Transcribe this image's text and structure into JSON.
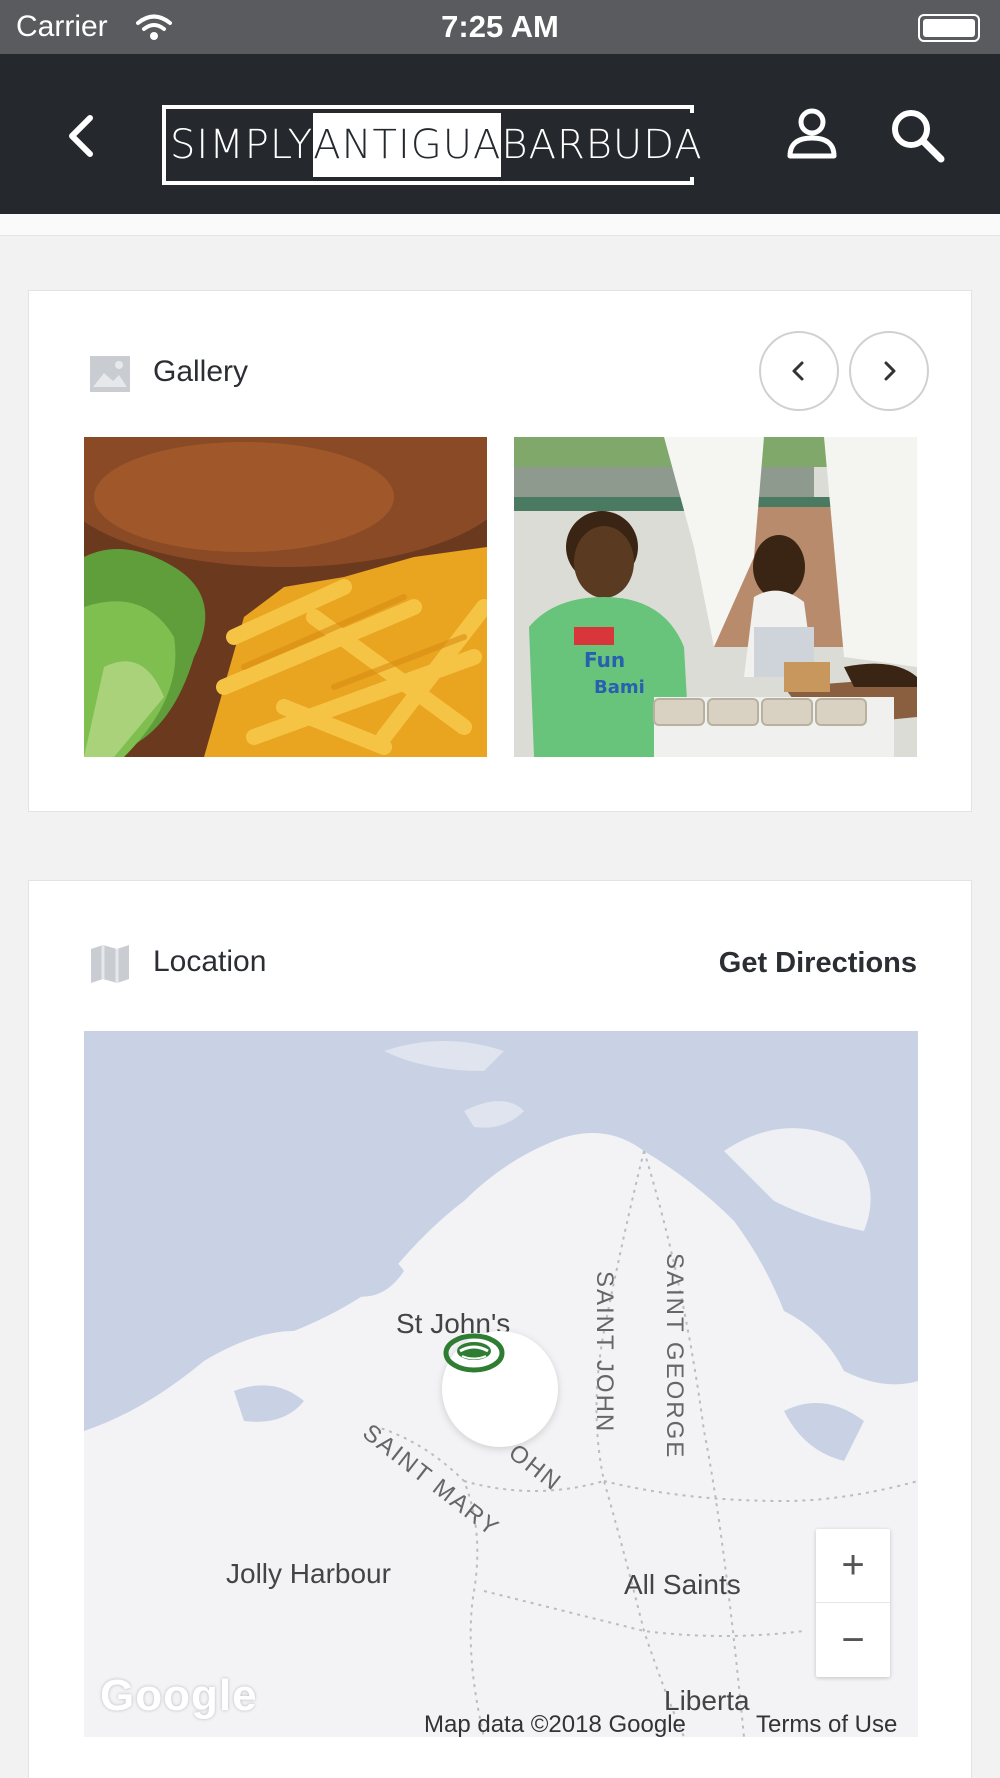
{
  "status_bar": {
    "carrier": "Carrier",
    "time": "7:25 AM"
  },
  "nav": {
    "logo_words": [
      "SIMPLY",
      "ANTIGUA",
      "BARBUDA"
    ],
    "back_icon": "chevron-left-icon",
    "user_icon": "user-icon",
    "search_icon": "search-icon"
  },
  "gallery": {
    "title": "Gallery",
    "icon": "image-icon",
    "images": [
      {
        "alt": "Fried fish with fries and salad"
      },
      {
        "alt": "Woman in green shirt at event table"
      }
    ]
  },
  "location": {
    "title": "Location",
    "icon": "map-icon",
    "directions_label": "Get Directions",
    "map": {
      "labels": {
        "st_johns": "St John's",
        "saint_john_vertical": "SAINT JOHN",
        "saint_george": "SAINT GEORGE",
        "saint_mary": "SAINT MARY",
        "john_partial": "OHN",
        "jolly_harbour": "Jolly Harbour",
        "all_saints": "All Saints",
        "liberta": "Liberta"
      },
      "zoom_in": "+",
      "zoom_out": "−",
      "provider": "Google",
      "attribution": "Map data ©2018 Google",
      "terms": "Terms of Use"
    }
  },
  "colors": {
    "nav_bg": "#25282c",
    "status_bg": "#5a5b5e",
    "map_water": "#c9d2e4",
    "map_land": "#f3f3f5"
  }
}
